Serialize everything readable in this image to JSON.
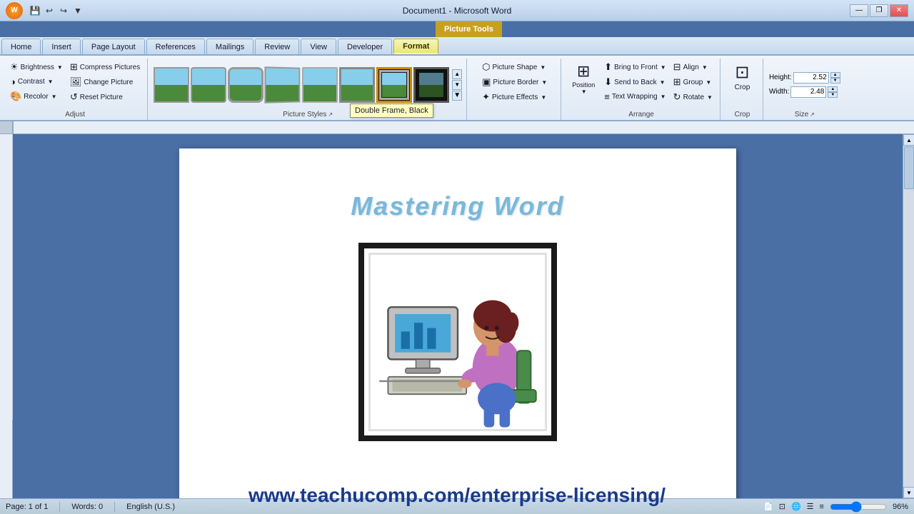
{
  "titlebar": {
    "doc_title": "Document1 - Microsoft Word",
    "context_tab_name": "Picture Tools",
    "buttons": {
      "minimize": "—",
      "restore": "❐",
      "close": "✕"
    }
  },
  "quickaccess": {
    "save": "💾",
    "undo": "↩",
    "redo": "↪",
    "more": "▼"
  },
  "tabs": [
    {
      "id": "home",
      "label": "Home"
    },
    {
      "id": "insert",
      "label": "Insert"
    },
    {
      "id": "pagelayout",
      "label": "Page Layout"
    },
    {
      "id": "references",
      "label": "References"
    },
    {
      "id": "mailings",
      "label": "Mailings"
    },
    {
      "id": "review",
      "label": "Review"
    },
    {
      "id": "view",
      "label": "View"
    },
    {
      "id": "developer",
      "label": "Developer"
    },
    {
      "id": "format",
      "label": "Format"
    }
  ],
  "ribbon": {
    "groups": {
      "adjust": {
        "label": "Adjust",
        "brightness": "Brightness",
        "contrast": "Contrast",
        "recolor": "Recolor",
        "compress": "Compress Pictures",
        "change": "Change Picture",
        "reset": "Reset Picture"
      },
      "picture_styles": {
        "label": "Picture Styles"
      },
      "picture_shape": {
        "label": "Picture Shape"
      },
      "picture_border": {
        "label": "Picture Border"
      },
      "picture_effects": {
        "label": "Picture Effects"
      },
      "arrange": {
        "label": "Arrange",
        "bring_front": "Bring to Front",
        "send_back": "Send to Back",
        "position": "Position",
        "text_wrapping": "Text Wrapping",
        "align": "Align",
        "group": "Group",
        "rotate": "Rotate"
      },
      "crop": {
        "label": "Crop",
        "button": "Crop"
      },
      "size": {
        "label": "Size",
        "height_label": "Height:",
        "width_label": "Width:",
        "height_val": "2.52",
        "width_val": "2.48",
        "expand": "↗"
      }
    }
  },
  "document": {
    "title": "Mastering Word",
    "page_label": "Page: 1 of 1",
    "words_label": "Words: 0"
  },
  "tooltip": "Double Frame, Black",
  "status": {
    "page": "Page: 1 of 1",
    "words": "Words: 0",
    "zoom": "96%"
  },
  "website": "www.teachucomp.com/enterprise-licensing/"
}
